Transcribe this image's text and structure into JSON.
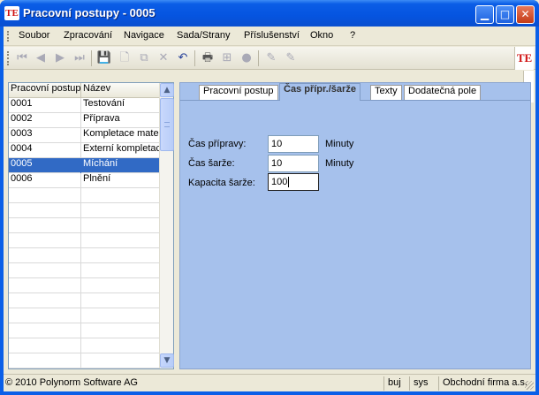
{
  "window": {
    "title": "Pracovní postupy - 0005",
    "logo": "TE"
  },
  "caption_buttons": {
    "minimize": "▁",
    "maximize": "□",
    "close": "✕"
  },
  "menu": {
    "items": [
      "Soubor",
      "Zpracování",
      "Navigace",
      "Sada/Strany",
      "Příslušenství",
      "Okno",
      "?"
    ]
  },
  "toolbar": {
    "icons": [
      "first-icon",
      "previous-icon",
      "next-icon",
      "last-icon",
      "save-icon",
      "new-icon",
      "copy-icon",
      "delete-icon",
      "undo-icon",
      "print-icon",
      "structure-icon",
      "circle-icon",
      "edit-icon",
      "edit2-icon"
    ]
  },
  "grid": {
    "columns": [
      "Pracovní postup",
      "Název"
    ],
    "rows": [
      {
        "code": "0001",
        "name": "Testování"
      },
      {
        "code": "0002",
        "name": "Příprava"
      },
      {
        "code": "0003",
        "name": "Kompletace mate"
      },
      {
        "code": "0004",
        "name": "Externí kompletac"
      },
      {
        "code": "0005",
        "name": "Míchání",
        "selected": true
      },
      {
        "code": "0006",
        "name": "Plnění"
      }
    ]
  },
  "tabs": [
    {
      "label": "Pracovní postup"
    },
    {
      "label": "Čas přípr./šarže",
      "active": true
    },
    {
      "label": "Texty"
    },
    {
      "label": "Dodatečná pole"
    }
  ],
  "form": {
    "prep_time": {
      "label": "Čas přípravy:",
      "value": "10",
      "unit": "Minuty"
    },
    "batch_time": {
      "label": "Čas šarže:",
      "value": "10",
      "unit": "Minuty"
    },
    "batch_capacity": {
      "label": "Kapacita šarže:",
      "value": "100"
    }
  },
  "status": {
    "copyright": "© 2010 Polynorm Software AG",
    "user": "buj",
    "system": "sys",
    "company": "Obchodní firma a.s."
  }
}
